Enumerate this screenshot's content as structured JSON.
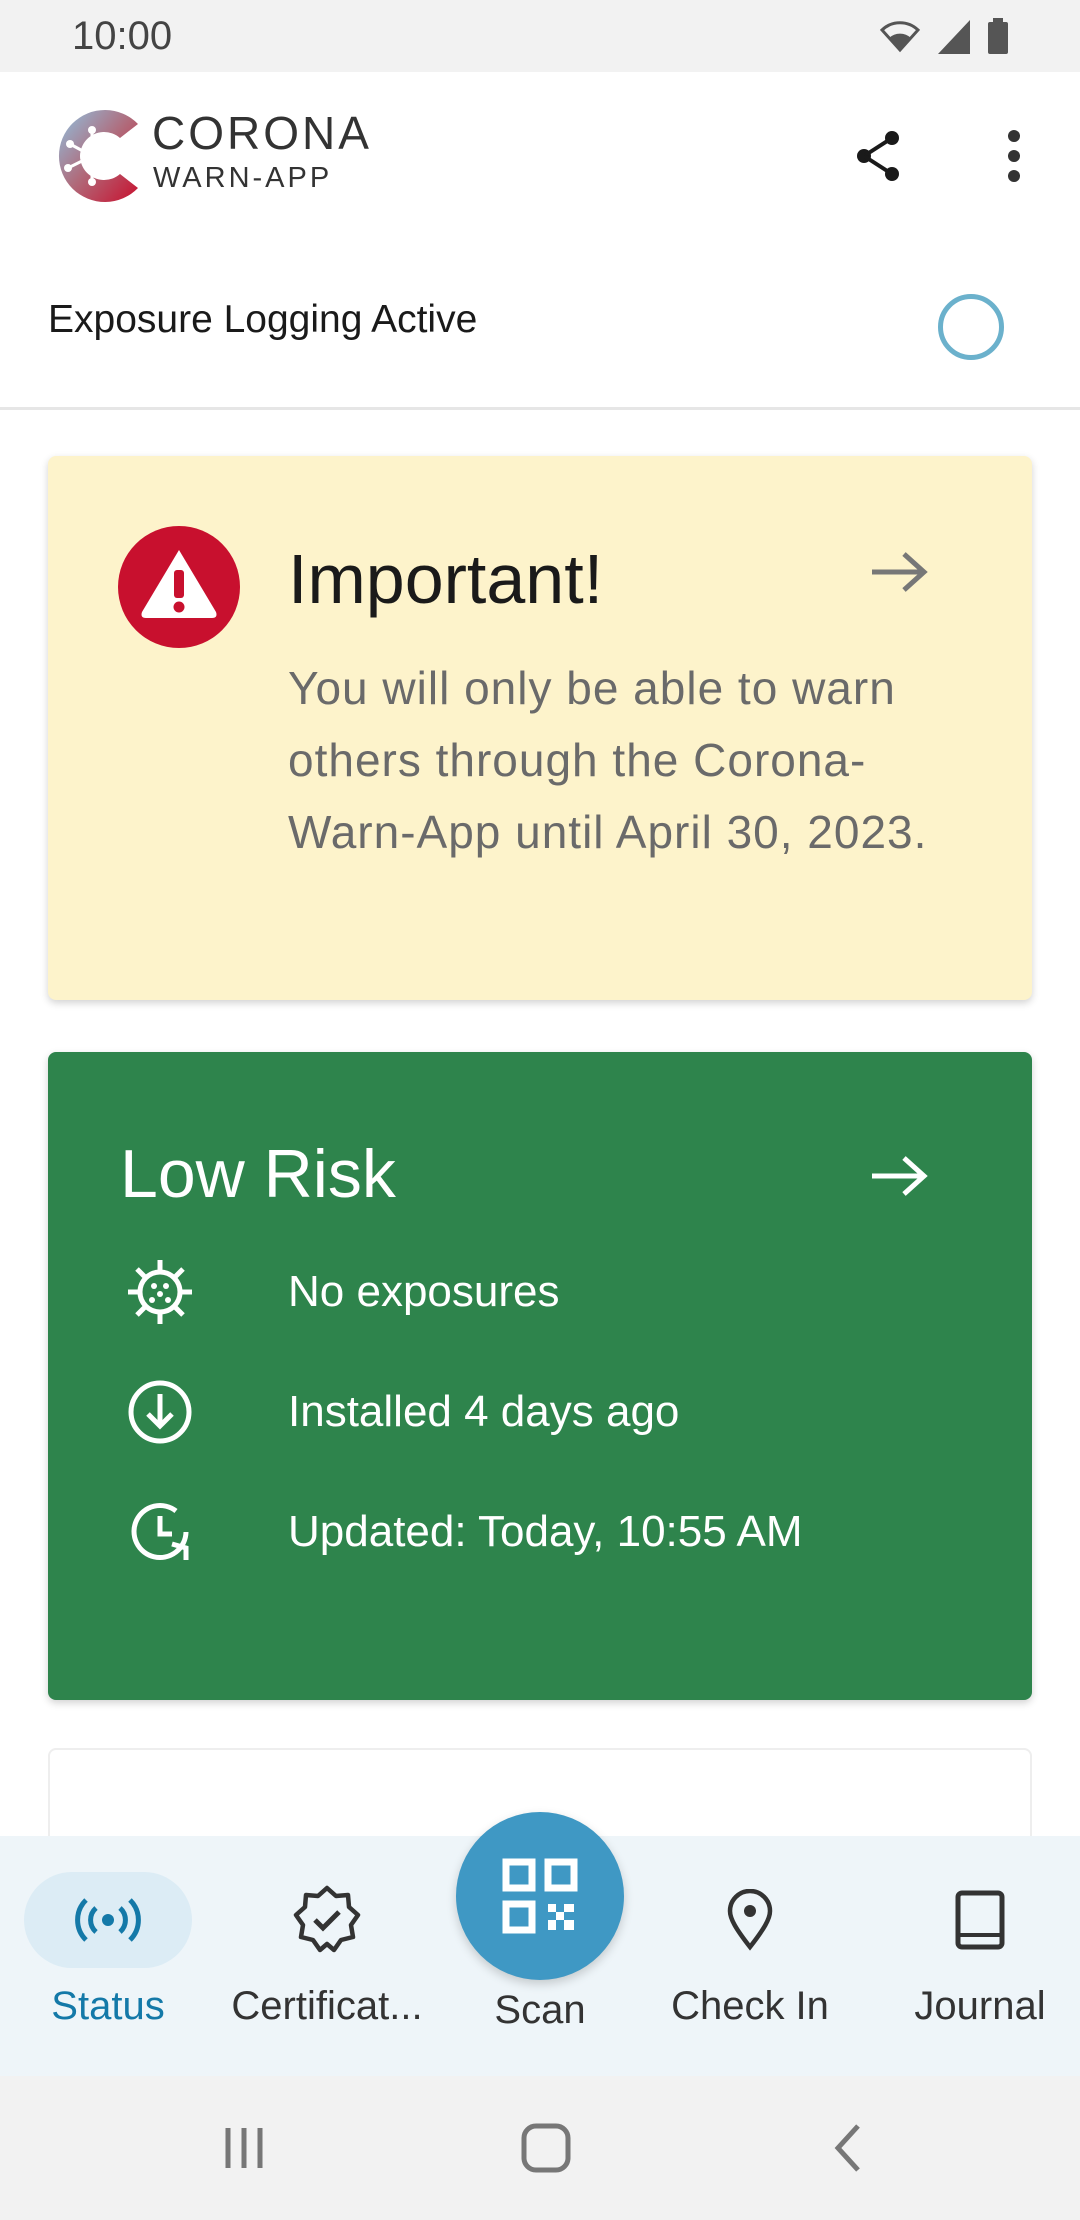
{
  "status_bar": {
    "time": "10:00",
    "icons": [
      "wifi-icon",
      "signal-icon",
      "battery-icon"
    ]
  },
  "header": {
    "logo_title": "CORONA",
    "logo_subtitle": "WARN-APP",
    "actions": [
      "share-icon",
      "more-vert-icon"
    ],
    "tracing_status": "Exposure Logging Active"
  },
  "important_card": {
    "title": "Important!",
    "body": "You will only be able to warn others through the Corona-Warn-App until April 30, 2023.",
    "icon": "warning-icon",
    "background": "#fdf3cb",
    "accent": "#c8102e"
  },
  "risk_card": {
    "title": "Low Risk",
    "background": "#2e844c",
    "rows": [
      {
        "icon": "virus-icon",
        "text": "No exposures"
      },
      {
        "icon": "download-circle-icon",
        "text": "Installed 4 days ago"
      },
      {
        "icon": "clock-refresh-icon",
        "text": "Updated: Today, 10:55 AM"
      }
    ]
  },
  "bottom_nav": {
    "active_color": "#1479a8",
    "fab_color": "#3f98c4",
    "items": [
      {
        "label": "Status",
        "icon": "broadcast-icon",
        "active": true
      },
      {
        "label": "Certificat...",
        "icon": "certificate-badge-icon",
        "active": false
      },
      {
        "label": "Scan",
        "icon": "qr-code-icon",
        "active": false
      },
      {
        "label": "Check In",
        "icon": "location-pin-icon",
        "active": false
      },
      {
        "label": "Journal",
        "icon": "book-icon",
        "active": false
      }
    ]
  },
  "system_nav": [
    "recents-icon",
    "home-icon",
    "back-icon"
  ]
}
